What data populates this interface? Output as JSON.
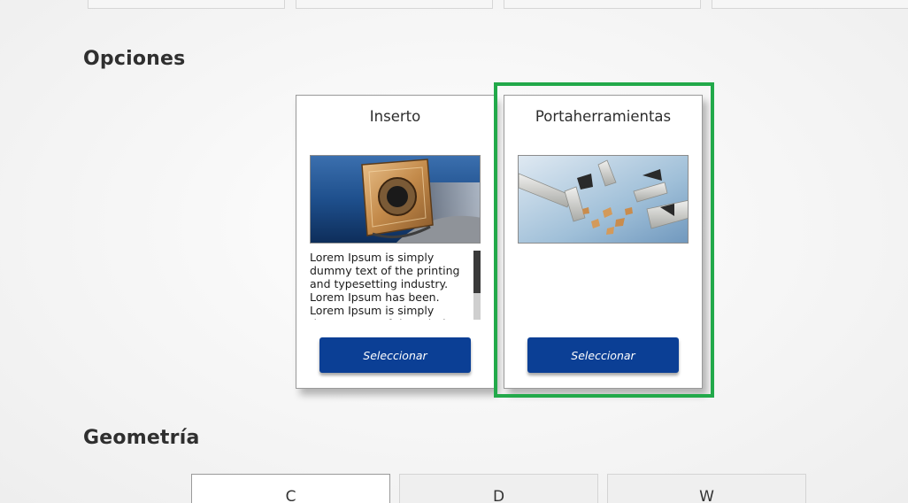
{
  "sections": {
    "options_title": "Opciones",
    "geometry_title": "Geometría"
  },
  "options": [
    {
      "title": "Inserto",
      "image_icon": "insert-photo",
      "description": "Lorem Ipsum is simply dummy text of the printing and typesetting industry. Lorem Ipsum has been. Lorem Ipsum is simply dummy text of the printing and typesetting industry.",
      "button_label": "Seleccionar",
      "selected": false
    },
    {
      "title": "Portaherramientas",
      "image_icon": "toolholder-photo",
      "description": "",
      "button_label": "Seleccionar",
      "selected": true
    }
  ],
  "geometry_tabs": [
    {
      "label": "C",
      "active": true
    },
    {
      "label": "D",
      "active": false
    },
    {
      "label": "W",
      "active": false
    }
  ],
  "colors": {
    "button_blue": "#0b3f95",
    "highlight_green": "#22a94a"
  }
}
